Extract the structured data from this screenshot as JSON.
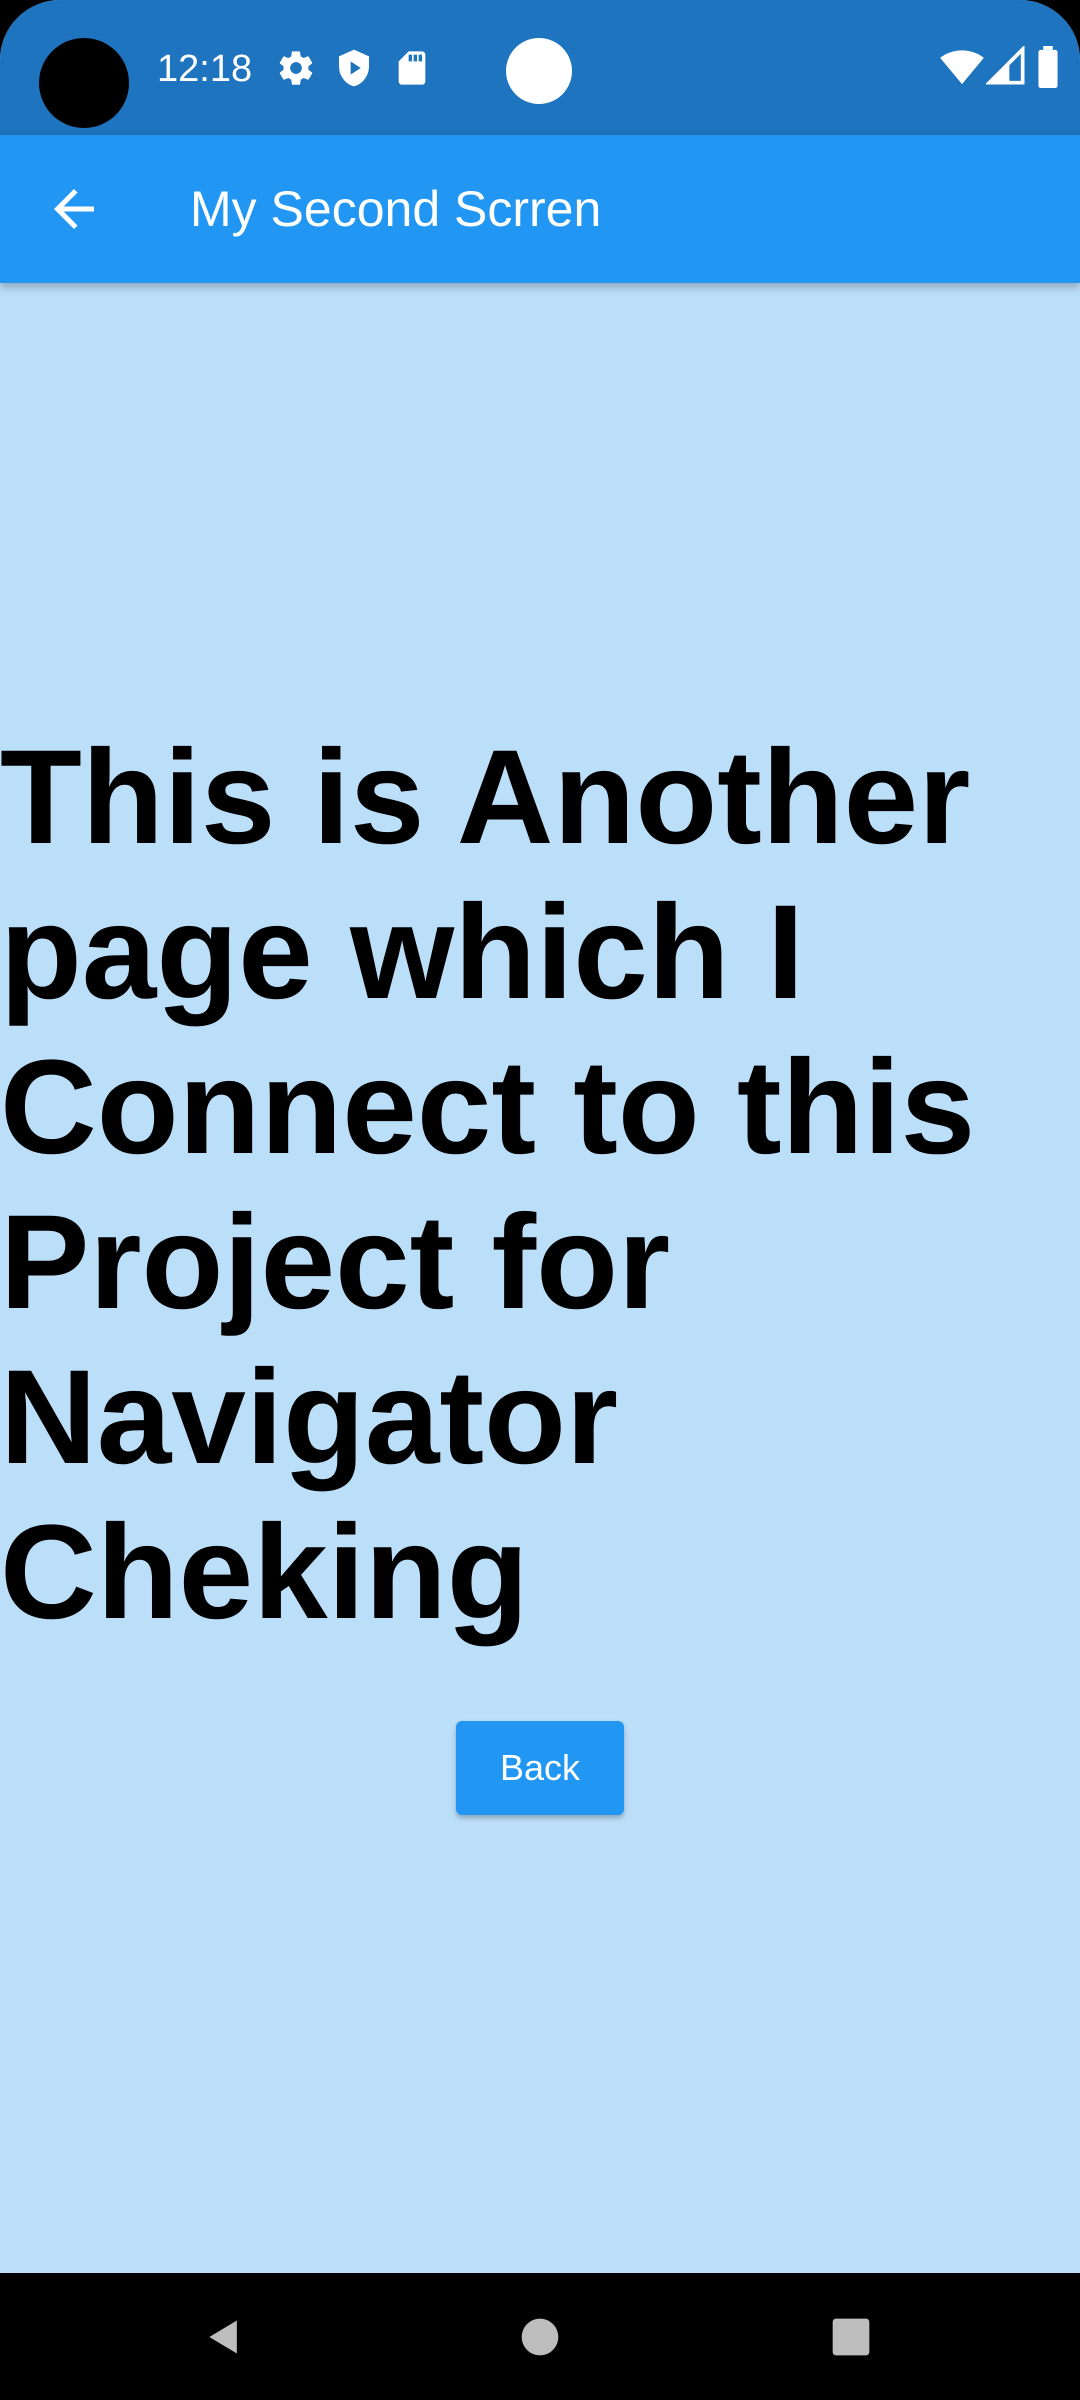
{
  "status_bar": {
    "time": "12:18",
    "icons": [
      "gear-icon",
      "shield-play-icon",
      "sd-card-icon",
      "wifi-icon",
      "signal-icon",
      "battery-icon"
    ],
    "background": "#1E74BE"
  },
  "app_bar": {
    "title": "My Second Scrren",
    "back_icon": "arrow-back-icon",
    "background": "#2196F3"
  },
  "main": {
    "background": "#BBDEF9",
    "body_text": "This is Another page which I Connect to this Project for Navigator Cheking",
    "back_button_label": "Back",
    "button_color": "#2196F3"
  },
  "nav_bar": {
    "items": [
      "back-triangle-icon",
      "home-circle-icon",
      "recents-square-icon"
    ]
  }
}
